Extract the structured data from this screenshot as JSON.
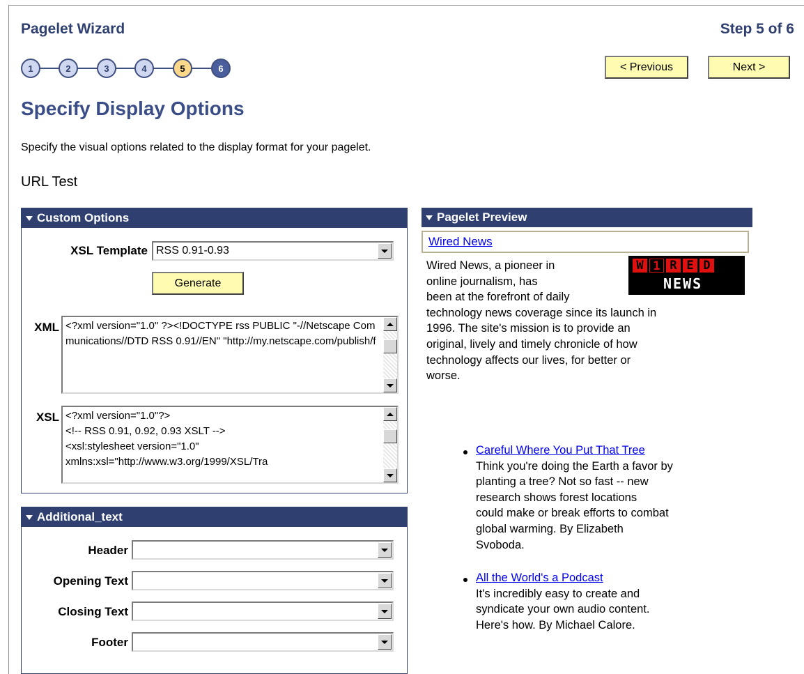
{
  "wizard": {
    "title": "Pagelet Wizard",
    "step_text": "Step 5 of 6",
    "steps": [
      "1",
      "2",
      "3",
      "4",
      "5",
      "6"
    ],
    "current_step": 5,
    "prev_label": "< Previous",
    "next_label": "Next >"
  },
  "page": {
    "title": "Specify Display Options",
    "instructions": "Specify the visual options related to the display format for your pagelet.",
    "pagelet_name": "URL Test"
  },
  "custom_options": {
    "header": "Custom Options",
    "xsl_template_label": "XSL Template",
    "xsl_template_value": "RSS 0.91-0.93",
    "generate_label": "Generate",
    "xml_label": "XML",
    "xml_value": "<?xml version=\"1.0\" ?><!DOCTYPE rss PUBLIC \"-//Netscape Communications//DTD RSS 0.91//EN\" \"http://my.netscape.com/publish/f",
    "xsl_label": "XSL",
    "xsl_value": "<?xml version=\"1.0\"?>\n<!-- RSS 0.91, 0.92, 0.93 XSLT -->\n<xsl:stylesheet version=\"1.0\"\nxmlns:xsl=\"http://www.w3.org/1999/XSL/Tra"
  },
  "additional_text": {
    "header": "Additional_text",
    "fields": [
      {
        "label": "Header",
        "value": ""
      },
      {
        "label": "Opening Text",
        "value": ""
      },
      {
        "label": "Closing Text",
        "value": ""
      },
      {
        "label": "Footer",
        "value": ""
      }
    ]
  },
  "preview": {
    "header": "Pagelet Preview",
    "link_title": "Wired News",
    "logo_top": [
      "W",
      "1",
      "R",
      "E",
      "D"
    ],
    "logo_bottom": "NEWS",
    "description_lines": [
      "Wired News, a pioneer in",
      "online journalism, has",
      "been at the forefront of daily",
      "technology news coverage since its launch in",
      "1996. The site's mission is to provide an",
      "original, lively and timely chronicle of how",
      "technology affects our lives, for better or",
      "worse."
    ],
    "items": [
      {
        "title": "Careful Where You Put That Tree",
        "lines": [
          "Think you're doing the Earth a favor by",
          "planting a tree? Not so fast -- new",
          "research shows forest locations",
          "could make or break efforts to combat",
          "global warming. By Elizabeth",
          "Svoboda."
        ]
      },
      {
        "title": "All the World's a Podcast",
        "lines": [
          "It's incredibly easy to create and",
          "syndicate your own audio content.",
          "Here's how. By Michael Calore."
        ]
      }
    ]
  }
}
